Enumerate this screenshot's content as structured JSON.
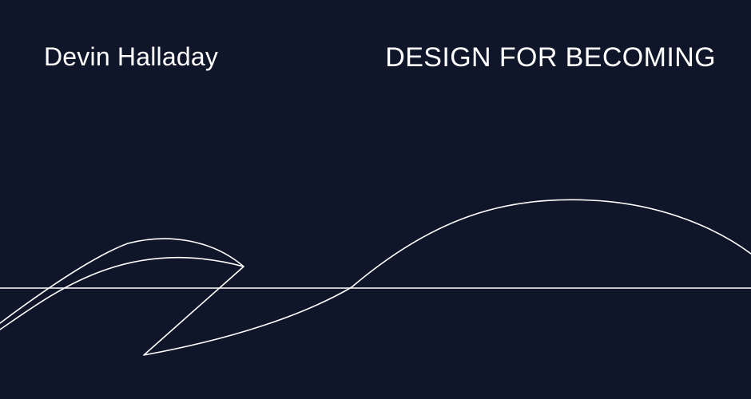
{
  "header": {
    "author_name": "Devin Halladay",
    "tagline": "DESIGN FOR BECOMING"
  },
  "artwork": {
    "stroke_color": "#ffffff",
    "background_color": "#101629"
  }
}
